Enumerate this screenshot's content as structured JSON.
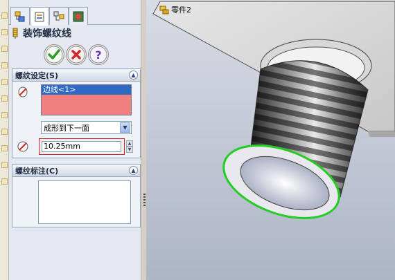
{
  "panel": {
    "title": "装饰螺纹线",
    "tabs": [
      {
        "icon": "feature-manager-icon",
        "active": false
      },
      {
        "icon": "property-manager-icon",
        "active": true
      },
      {
        "icon": "configuration-manager-icon",
        "active": false
      },
      {
        "icon": "display-manager-icon",
        "active": false
      }
    ],
    "actions": {
      "ok_icon": "ok-check-icon",
      "cancel_icon": "cancel-x-icon",
      "help_icon": "help-question-icon"
    }
  },
  "thread_settings": {
    "header": "螺纹设定(S)",
    "edge_selection": "边线<1>",
    "end_condition": "成形到下一面",
    "diameter": "10.25mm"
  },
  "thread_callout": {
    "header": "螺纹标注(C)",
    "value": ""
  },
  "viewport": {
    "tree_item": "零件2"
  },
  "colors": {
    "selection_box": "#f08080",
    "selected_item": "#316ac5",
    "highlight_edge": "#22cc22",
    "highlight_box": "#e02020"
  }
}
